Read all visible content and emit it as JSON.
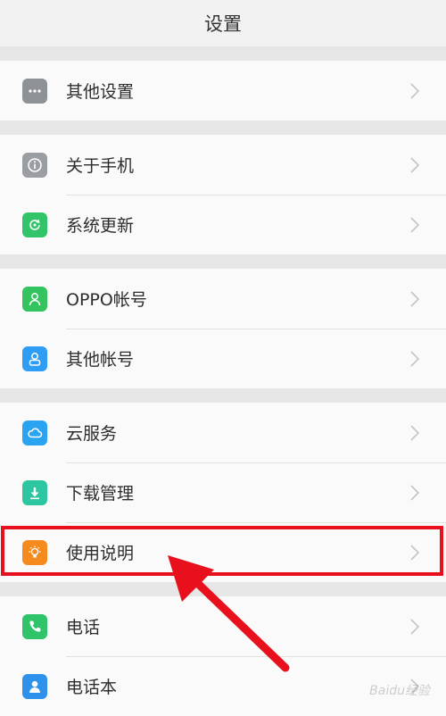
{
  "header": {
    "title": "设置"
  },
  "groups": [
    {
      "items": [
        {
          "label": "其他设置",
          "icon": "more-icon",
          "color": "#8e9196"
        }
      ]
    },
    {
      "items": [
        {
          "label": "关于手机",
          "icon": "info-icon",
          "color": "#9a9da2"
        },
        {
          "label": "系统更新",
          "icon": "update-icon",
          "color": "#33c46b"
        }
      ]
    },
    {
      "items": [
        {
          "label": "OPPO帐号",
          "icon": "user-icon",
          "color": "#34c45f"
        },
        {
          "label": "其他帐号",
          "icon": "user-outline-icon",
          "color": "#2e9df3"
        }
      ]
    },
    {
      "items": [
        {
          "label": "云服务",
          "icon": "cloud-icon",
          "color": "#2aa3f0"
        },
        {
          "label": "下载管理",
          "icon": "download-icon",
          "color": "#2dc6a0"
        },
        {
          "label": "使用说明",
          "icon": "lightbulb-icon",
          "color": "#f58a1f"
        }
      ]
    },
    {
      "items": [
        {
          "label": "电话",
          "icon": "phone-icon",
          "color": "#2fc46a"
        },
        {
          "label": "电话本",
          "icon": "contacts-icon",
          "color": "#2e92ea"
        }
      ]
    }
  ],
  "annotation": {
    "highlight_color": "#e8101c",
    "target": "使用说明"
  },
  "watermark": "Baidu经验"
}
